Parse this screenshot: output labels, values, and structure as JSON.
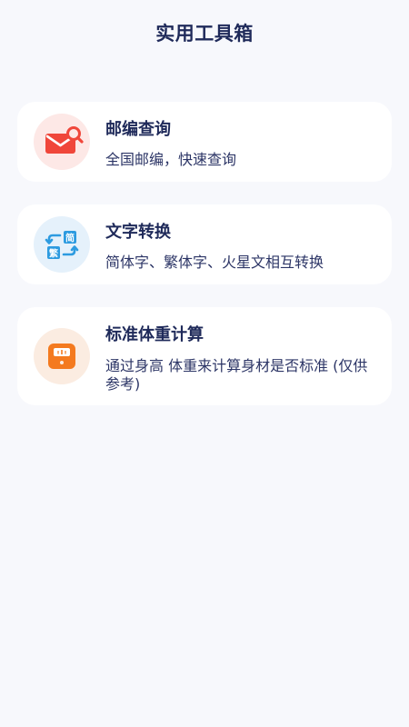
{
  "header": {
    "title": "实用工具箱"
  },
  "tools": [
    {
      "title": "邮编查询",
      "description": "全国邮编，快速查询",
      "icon": "envelope-search-icon"
    },
    {
      "title": "文字转换",
      "description": "简体字、繁体字、火星文相互转换",
      "icon": "text-convert-icon",
      "icon_glyph_simplified": "简",
      "icon_glyph_traditional": "繁"
    },
    {
      "title": "标准体重计算",
      "description": "通过身高 体重来计算身材是否标准 (仅供参考)",
      "icon": "weight-scale-icon"
    }
  ],
  "colors": {
    "background": "#f7f8fc",
    "title_text": "#1f2a5a",
    "mail_red": "#f0463a",
    "convert_blue": "#2d9be0",
    "scale_orange": "#f47a1f"
  }
}
